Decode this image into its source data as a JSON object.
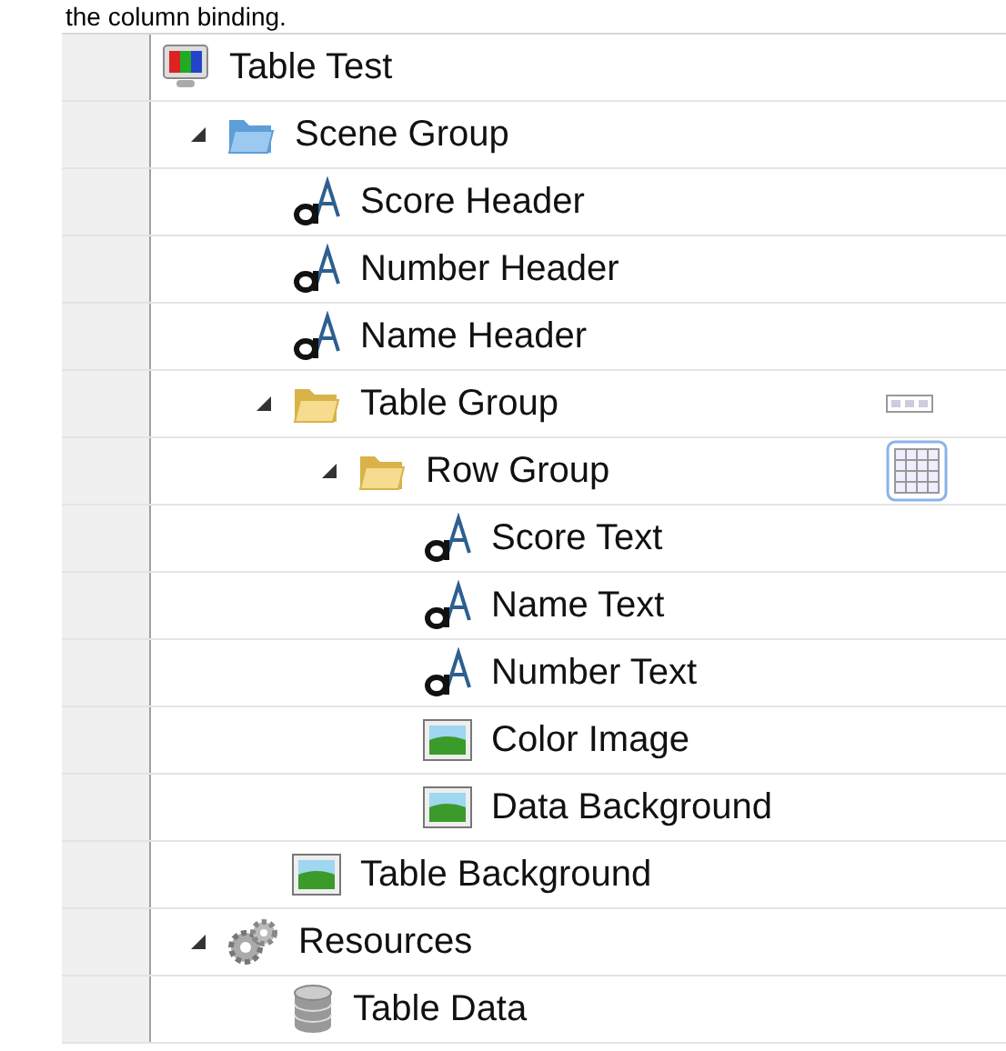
{
  "caption": "the column binding.",
  "tree": [
    {
      "label": "Table Test",
      "kind": "scene",
      "children": [
        {
          "label": "Scene Group",
          "kind": "group",
          "expanded": true,
          "children": [
            {
              "label": "Score Header",
              "kind": "text"
            },
            {
              "label": "Number Header",
              "kind": "text"
            },
            {
              "label": "Name Header",
              "kind": "text"
            },
            {
              "label": "Table Group",
              "kind": "folder",
              "expanded": true,
              "badge": {
                "kind": "columns"
              },
              "children": [
                {
                  "label": "Row Group",
                  "kind": "folder",
                  "expanded": true,
                  "badge": {
                    "kind": "grid"
                  },
                  "children": [
                    {
                      "label": "Score Text",
                      "kind": "text"
                    },
                    {
                      "label": "Name Text",
                      "kind": "text"
                    },
                    {
                      "label": "Number Text",
                      "kind": "text"
                    },
                    {
                      "label": "Color Image",
                      "kind": "image"
                    },
                    {
                      "label": "Data Background",
                      "kind": "image"
                    }
                  ]
                }
              ]
            },
            {
              "label": "Table Background",
              "kind": "image"
            }
          ]
        },
        {
          "label": "Resources",
          "kind": "resources",
          "expanded": true,
          "children": [
            {
              "label": "Table Data",
              "kind": "data"
            }
          ]
        }
      ]
    }
  ]
}
